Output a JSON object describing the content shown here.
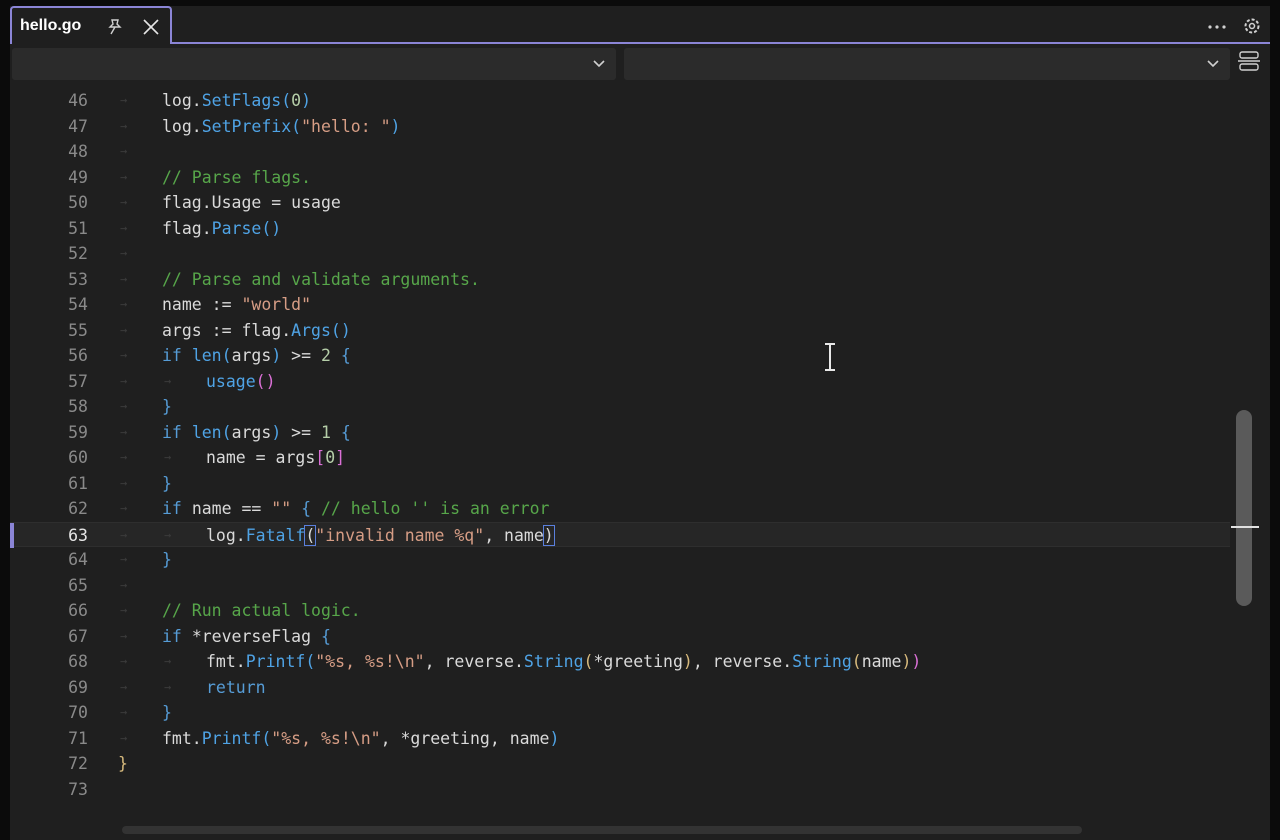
{
  "tab": {
    "title": "hello.go"
  },
  "navbar": {
    "left_dropdown": "",
    "right_dropdown": ""
  },
  "editor": {
    "lines": [
      {
        "num": "46",
        "tok": [
          [
            "log.",
            "t"
          ],
          [
            "SetFlags",
            "f"
          ],
          [
            "(",
            "f"
          ],
          [
            "0",
            "n"
          ],
          [
            ")",
            "f"
          ]
        ]
      },
      {
        "num": "47",
        "tok": [
          [
            "log.",
            "t"
          ],
          [
            "SetPrefix",
            "f"
          ],
          [
            "(",
            "f"
          ],
          [
            "\"hello: \"",
            "s"
          ],
          [
            ")",
            "f"
          ]
        ]
      },
      {
        "num": "48",
        "tok": []
      },
      {
        "num": "49",
        "tok": [
          [
            "// Parse flags.",
            "c"
          ]
        ]
      },
      {
        "num": "50",
        "tok": [
          [
            "flag.Usage = usage",
            "t"
          ]
        ]
      },
      {
        "num": "51",
        "tok": [
          [
            "flag.",
            "t"
          ],
          [
            "Parse",
            "f"
          ],
          [
            "()",
            "f"
          ]
        ]
      },
      {
        "num": "52",
        "tok": []
      },
      {
        "num": "53",
        "tok": [
          [
            "// Parse and validate arguments.",
            "c"
          ]
        ]
      },
      {
        "num": "54",
        "tok": [
          [
            "name := ",
            "t"
          ],
          [
            "\"world\"",
            "s"
          ]
        ]
      },
      {
        "num": "55",
        "tok": [
          [
            "args := flag.",
            "t"
          ],
          [
            "Args",
            "f"
          ],
          [
            "()",
            "f"
          ]
        ]
      },
      {
        "num": "56",
        "tok": [
          [
            "if ",
            "k"
          ],
          [
            "len",
            "f"
          ],
          [
            "(",
            "f"
          ],
          [
            "args",
            "t"
          ],
          [
            ")",
            "f"
          ],
          [
            " >= ",
            "t"
          ],
          [
            "2",
            "n"
          ],
          [
            " {",
            "k"
          ]
        ]
      },
      {
        "num": "57",
        "indent": 2,
        "tok": [
          [
            "usage",
            "f"
          ],
          [
            "()",
            "m"
          ]
        ]
      },
      {
        "num": "58",
        "tok": [
          [
            "}",
            "k"
          ]
        ]
      },
      {
        "num": "59",
        "tok": [
          [
            "if ",
            "k"
          ],
          [
            "len",
            "f"
          ],
          [
            "(",
            "f"
          ],
          [
            "args",
            "t"
          ],
          [
            ")",
            "f"
          ],
          [
            " >= ",
            "t"
          ],
          [
            "1",
            "n"
          ],
          [
            " {",
            "k"
          ]
        ]
      },
      {
        "num": "60",
        "indent": 2,
        "tok": [
          [
            "name = args",
            "t"
          ],
          [
            "[",
            "m"
          ],
          [
            "0",
            "n"
          ],
          [
            "]",
            "m"
          ]
        ]
      },
      {
        "num": "61",
        "tok": [
          [
            "}",
            "k"
          ]
        ]
      },
      {
        "num": "62",
        "tok": [
          [
            "if ",
            "k"
          ],
          [
            "name == ",
            "t"
          ],
          [
            "\"\"",
            "s"
          ],
          [
            " {",
            "k"
          ],
          [
            " // hello '' is an error",
            "c"
          ]
        ]
      },
      {
        "num": "63",
        "indent": 2,
        "current": true,
        "tok": [
          [
            "log.",
            "t"
          ],
          [
            "Fatalf",
            "f"
          ],
          [
            "(",
            "hl"
          ],
          [
            "\"invalid name %q\"",
            "s"
          ],
          [
            ", name",
            "t"
          ],
          [
            ")",
            "hl"
          ]
        ]
      },
      {
        "num": "64",
        "tok": [
          [
            "}",
            "k"
          ]
        ]
      },
      {
        "num": "65",
        "tok": []
      },
      {
        "num": "66",
        "tok": [
          [
            "// Run actual logic.",
            "c"
          ]
        ]
      },
      {
        "num": "67",
        "tok": [
          [
            "if ",
            "k"
          ],
          [
            "*reverseFlag",
            "t"
          ],
          [
            " {",
            "k"
          ]
        ]
      },
      {
        "num": "68",
        "indent": 2,
        "tok": [
          [
            "fmt.",
            "t"
          ],
          [
            "Printf",
            "f"
          ],
          [
            "(",
            "f"
          ],
          [
            "\"%s, %s!\\n\"",
            "s"
          ],
          [
            ", reverse.",
            "t"
          ],
          [
            "String",
            "f"
          ],
          [
            "(",
            "p"
          ],
          [
            "*greeting",
            "t"
          ],
          [
            ")",
            "p"
          ],
          [
            ", reverse.",
            "t"
          ],
          [
            "String",
            "f"
          ],
          [
            "(",
            "p"
          ],
          [
            "name",
            "t"
          ],
          [
            ")",
            "p"
          ],
          [
            ")",
            "m"
          ]
        ]
      },
      {
        "num": "69",
        "indent": 2,
        "tok": [
          [
            "return",
            "k"
          ]
        ]
      },
      {
        "num": "70",
        "tok": [
          [
            "}",
            "k"
          ]
        ]
      },
      {
        "num": "71",
        "tok": [
          [
            "fmt.",
            "t"
          ],
          [
            "Printf",
            "f"
          ],
          [
            "(",
            "f"
          ],
          [
            "\"%s, %s!\\n\"",
            "s"
          ],
          [
            ", *greeting, name",
            "t"
          ],
          [
            ")",
            "f"
          ]
        ]
      },
      {
        "num": "72",
        "indent": -1,
        "tok": [
          [
            "}",
            "p"
          ]
        ]
      },
      {
        "num": "73",
        "indent": -1,
        "tok": []
      }
    ]
  },
  "colors": {
    "accent": "#8b85d6",
    "background": "#1f1f1f",
    "keyword": "#569cd6",
    "string": "#d69d85",
    "comment": "#57a64a"
  },
  "icons": [
    "pin-icon",
    "close-icon",
    "more-icon",
    "gear-icon",
    "chevron-down-icon",
    "split-icon"
  ]
}
